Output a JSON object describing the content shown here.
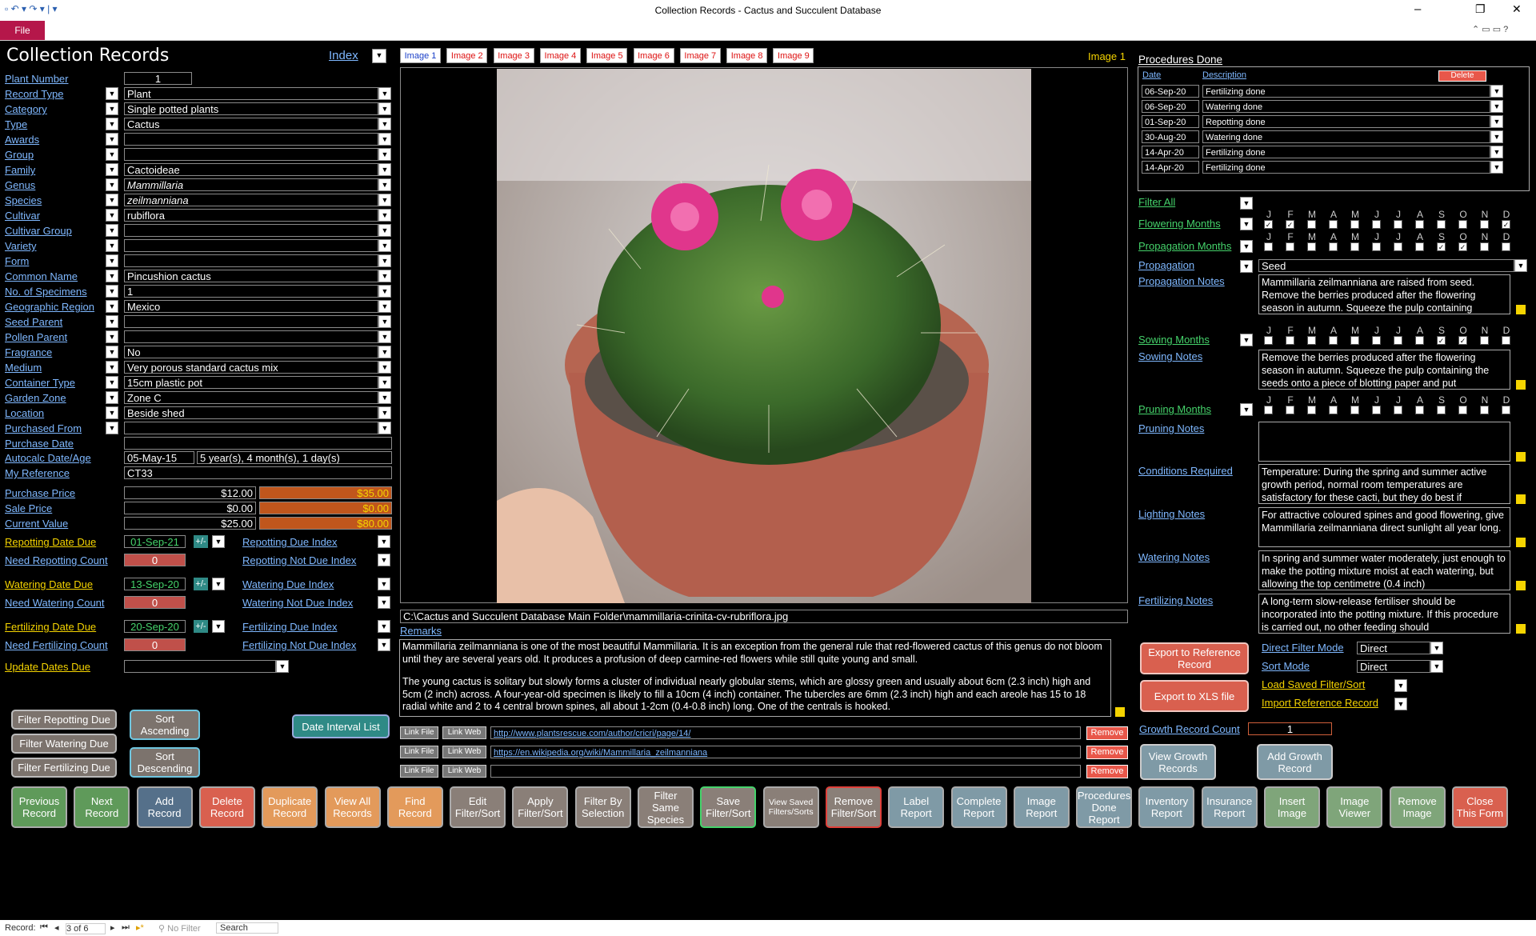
{
  "window": {
    "title": "Collection Records  -  Cactus and Succulent Database",
    "file_label": "File"
  },
  "form": {
    "title": "Collection Records",
    "index_label": "Index"
  },
  "left_fields": [
    {
      "label": "Plant Number",
      "value": "1",
      "drop": false
    },
    {
      "label": "Record Type",
      "value": "Plant",
      "drop": true
    },
    {
      "label": "Category",
      "value": "Single potted plants",
      "drop": true
    },
    {
      "label": "Type",
      "value": "Cactus",
      "drop": true
    },
    {
      "label": "Awards",
      "value": "",
      "drop": true
    },
    {
      "label": "Group",
      "value": "",
      "drop": true
    },
    {
      "label": "Family",
      "value": "Cactoideae",
      "drop": true
    },
    {
      "label": "Genus",
      "value": "Mammillaria",
      "drop": true
    },
    {
      "label": "Species",
      "value": "zeilmanniana",
      "drop": true
    },
    {
      "label": "Cultivar",
      "value": "rubiflora",
      "drop": true
    },
    {
      "label": "Cultivar Group",
      "value": "",
      "drop": true
    },
    {
      "label": "Variety",
      "value": "",
      "drop": true
    },
    {
      "label": "Form",
      "value": "",
      "drop": true
    },
    {
      "label": "Common Name",
      "value": "Pincushion cactus",
      "drop": true
    },
    {
      "label": "No. of Specimens",
      "value": "1",
      "drop": true
    },
    {
      "label": "Geographic Region",
      "value": "Mexico",
      "drop": true
    },
    {
      "label": "Seed Parent",
      "value": "",
      "drop": true
    },
    {
      "label": "Pollen Parent",
      "value": "",
      "drop": true
    },
    {
      "label": "Fragrance",
      "value": "No",
      "drop": true
    },
    {
      "label": "Medium",
      "value": "Very porous standard cactus mix",
      "drop": true
    },
    {
      "label": "Container Type",
      "value": "15cm plastic pot",
      "drop": true
    },
    {
      "label": "Garden Zone",
      "value": "Zone C",
      "drop": true
    },
    {
      "label": "Location",
      "value": "Beside shed",
      "drop": true
    },
    {
      "label": "Purchased From",
      "value": "",
      "drop": true
    },
    {
      "label": "Purchase Date",
      "value": "",
      "drop": false
    }
  ],
  "autocalc": {
    "label": "Autocalc Date/Age",
    "date": "05-May-15",
    "age": "5 year(s), 4 month(s), 1 day(s)"
  },
  "my_reference": {
    "label": "My Reference",
    "value": "CT33"
  },
  "prices": [
    {
      "label": "Purchase Price",
      "value": "$12.00",
      "alt": "$35.00"
    },
    {
      "label": "Sale Price",
      "value": "$0.00",
      "alt": "$0.00"
    },
    {
      "label": "Current Value",
      "value": "$25.00",
      "alt": "$80.00"
    }
  ],
  "due": {
    "repotting": {
      "label": "Repotting Date Due",
      "date": "01-Sep-21",
      "count_label": "Need Repotting Count",
      "count": "0",
      "index_label": "Repotting Due Index",
      "notdue_label": "Repotting Not Due Index"
    },
    "watering": {
      "label": "Watering Date Due",
      "date": "13-Sep-20",
      "count_label": "Need Watering Count",
      "count": "0",
      "index_label": "Watering Due Index",
      "notdue_label": "Watering Not Due Index"
    },
    "fertilizing": {
      "label": "Fertilizing Date Due",
      "date": "20-Sep-20",
      "count_label": "Need Fertilizing Count",
      "count": "0",
      "index_label": "Fertilizing Due Index",
      "notdue_label": "Fertilizing Not Due Index"
    },
    "pm_label": "+/-",
    "update_label": "Update Dates Due"
  },
  "filter_buttons": {
    "repotting": "Filter Repotting Due",
    "watering": "Filter Watering Due",
    "fertilizing": "Filter Fertilizing Due",
    "sort_asc": "Sort Ascending",
    "sort_desc": "Sort Descending",
    "date_interval": "Date Interval List"
  },
  "image_tabs": [
    "Image 1",
    "Image 2",
    "Image 3",
    "Image 4",
    "Image 5",
    "Image 6",
    "Image 7",
    "Image 8",
    "Image 9"
  ],
  "image_current": "Image 1",
  "image_path": "C:\\Cactus and Succulent Database Main Folder\\mammillaria-crinita-cv-rubriflora.jpg",
  "remarks": {
    "label": "Remarks",
    "p1": "Mammillaria zeilmanniana is one of the most beautiful Mammillaria. It is an exception from the general rule that red-flowered cactus of this genus do not bloom until they are several years old. It produces a profusion of deep carmine-red flowers while still quite young  and small.",
    "p2": "The young cactus is solitary but slowly forms a cluster of individual nearly globular stems, which are glossy green and usually  about 6cm (2.3 inch) high and 5cm (2 inch) across. A four-year-old specimen is likely to fill a 10cm (4 inch) container. The tubercles are 6mm (2.3 inch) high and each areole has 15 to 18 radial white and 2 to 4 central brown spines, all about 1-2cm (0.4-0.8 inch) long. One of the centrals is hooked."
  },
  "links": {
    "link_file": "Link File",
    "link_web": "Link Web",
    "remove": "Remove",
    "urls": [
      "http://www.plantsrescue.com/author/cricri/page/14/",
      "https://en.wikipedia.org/wiki/Mammillaria_zeilmanniana",
      ""
    ]
  },
  "procedures": {
    "title": "Procedures Done",
    "date_header": "Date",
    "desc_header": "Description",
    "delete_label": "Delete",
    "rows": [
      {
        "date": "06-Sep-20",
        "desc": "Fertilizing done"
      },
      {
        "date": "06-Sep-20",
        "desc": "Watering done"
      },
      {
        "date": "01-Sep-20",
        "desc": "Repotting done"
      },
      {
        "date": "30-Aug-20",
        "desc": "Watering done"
      },
      {
        "date": "14-Apr-20",
        "desc": "Fertilizing done"
      },
      {
        "date": "14-Apr-20",
        "desc": "Fertilizing done"
      }
    ]
  },
  "months": [
    "J",
    "F",
    "M",
    "A",
    "M",
    "J",
    "J",
    "A",
    "S",
    "O",
    "N",
    "D"
  ],
  "filter_all": "Filter All",
  "month_rows": [
    {
      "label": "Flowering Months",
      "checked": [
        1,
        1,
        0,
        0,
        0,
        0,
        0,
        0,
        0,
        0,
        0,
        1
      ]
    },
    {
      "label": "Propagation Months",
      "checked": [
        0,
        0,
        0,
        0,
        0,
        0,
        0,
        0,
        1,
        1,
        0,
        0
      ]
    },
    {
      "label": "Sowing Months",
      "checked": [
        0,
        0,
        0,
        0,
        0,
        0,
        0,
        0,
        1,
        1,
        0,
        0
      ]
    },
    {
      "label": "Pruning Months",
      "checked": [
        0,
        0,
        0,
        0,
        0,
        0,
        0,
        0,
        0,
        0,
        0,
        0
      ]
    }
  ],
  "propagation": {
    "label": "Propagation",
    "value": "Seed"
  },
  "notes": {
    "propagation": {
      "label": "Propagation Notes",
      "text": "Mammillaria zeilmanniana are raised from seed. Remove the berries produced after the flowering season in autumn. Squeeze the pulp containing"
    },
    "sowing": {
      "label": "Sowing Notes",
      "text": "Remove the berries produced after the flowering season in autumn. Squeeze the pulp containing the seeds onto a piece of blotting paper and put"
    },
    "pruning": {
      "label": "Pruning Notes",
      "text": ""
    },
    "conditions": {
      "label": "Conditions Required",
      "text": "Temperature: During the spring and summer active growth period, normal room temperatures are satisfactory for these cacti, but they do best if"
    },
    "lighting": {
      "label": "Lighting Notes",
      "text": "For attractive coloured spines and good flowering, give Mammillaria zeilmanniana direct sunlight all year long."
    },
    "watering": {
      "label": "Watering Notes",
      "text": "In spring and summer water moderately, just enough to make the potting mixture moist at each watering, but allowing the top centimetre (0.4 inch)"
    },
    "fertilizing": {
      "label": "Fertilizing Notes",
      "text": "A long-term slow-release fertiliser should be incorporated into the potting mixture. If this procedure is carried out, no other feeding should"
    }
  },
  "right_actions": {
    "export_ref": "Export to Reference Record",
    "export_xls": "Export to XLS file",
    "direct_filter_label": "Direct Filter Mode",
    "direct_filter_value": "Direct",
    "sort_mode_label": "Sort Mode",
    "sort_mode_value": "Direct",
    "load_saved": "Load Saved Filter/Sort",
    "import_ref": "Import Reference Record",
    "growth_count_label": "Growth Record Count",
    "growth_count": "1",
    "view_growth": "View Growth Records",
    "add_growth": "Add Growth Record"
  },
  "bottom_buttons": [
    {
      "label": "Previous Record",
      "color": "#5f9a5a"
    },
    {
      "label": "Next Record",
      "color": "#5f9a5a"
    },
    {
      "label": "Add Record",
      "color": "#55708a"
    },
    {
      "label": "Delete Record",
      "color": "#d9604f"
    },
    {
      "label": "Duplicate Record",
      "color": "#e39a5b"
    },
    {
      "label": "View All Records",
      "color": "#e39a5b"
    },
    {
      "label": "Find Record",
      "color": "#e39a5b"
    },
    {
      "label": "Edit Filter/Sort",
      "color": "#8a7f78"
    },
    {
      "label": "Apply Filter/Sort",
      "color": "#8a7f78"
    },
    {
      "label": "Filter By Selection",
      "color": "#8a7f78"
    },
    {
      "label": "Filter Same Species",
      "color": "#8a7f78"
    },
    {
      "label": "Save Filter/Sort",
      "color": "#8a7f78"
    },
    {
      "label": "View Saved Filters/Sorts",
      "color": "#8a7f78"
    },
    {
      "label": "Remove Filter/Sort",
      "color": "#8a7f78"
    },
    {
      "label": "Label Report",
      "color": "#7f9aa6"
    },
    {
      "label": "Complete Report",
      "color": "#7f9aa6"
    },
    {
      "label": "Image Report",
      "color": "#7f9aa6"
    },
    {
      "label": "Procedures Done Report",
      "color": "#7f9aa6"
    },
    {
      "label": "Inventory Report",
      "color": "#7f9aa6"
    },
    {
      "label": "Insurance Report",
      "color": "#7f9aa6"
    },
    {
      "label": "Insert Image",
      "color": "#7fa57a"
    },
    {
      "label": "Image Viewer",
      "color": "#7fa57a"
    },
    {
      "label": "Remove Image",
      "color": "#7fa57a"
    },
    {
      "label": "Close This Form",
      "color": "#d9604f"
    }
  ],
  "status": {
    "record_label": "Record:",
    "position": "3 of 6",
    "no_filter": "No Filter",
    "search": "Search"
  }
}
